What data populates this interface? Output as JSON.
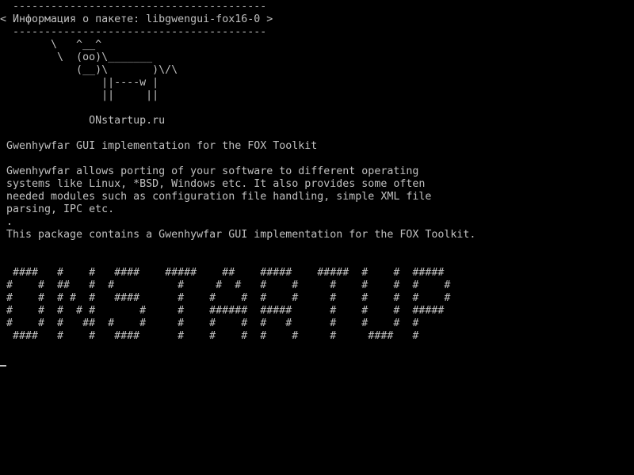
{
  "terminal": {
    "colors": {
      "background": "#000000",
      "foreground": "#c0c0c0"
    },
    "cowsay": {
      "border_top": " ----------------------------------------",
      "title": "< Информация о пакете: libgwengui-fox16-0 >",
      "border_bottom": " ----------------------------------------",
      "cow": [
        "       \\   ^__^",
        "        \\  (oo)\\_______",
        "           (__)\\       )\\/\\",
        "               ||----w |",
        "               ||     ||"
      ],
      "site": "             ONstartup.ru"
    },
    "description": {
      "summary": "Gwenhywfar GUI implementation for the FOX Toolkit",
      "body_lines": [
        "Gwenhywfar allows porting of your software to different operating",
        "systems like Linux, *BSD, Windows etc. It also provides some often",
        "needed modules such as configuration file handling, simple XML file",
        "parsing, IPC etc."
      ],
      "dot": ".",
      "package_note": "This package contains a Gwenhywfar GUI implementation for the FOX Toolkit."
    },
    "banner": [
      " ####   #    #   ####    #####    ##    #####    #####  #    #  #####",
      "#    #  ##   #  #          #     #  #   #    #     #    #    #  #    #",
      "#    #  # #  #   ####      #    #    #  #    #     #    #    #  #    #",
      "#    #  #  # #       #     #    ######  #####      #    #    #  #####",
      "#    #  #   ##  #    #     #    #    #  #   #      #    #    #  #",
      " ####   #    #   ####      #    #    #  #    #     #     ####   #"
    ]
  }
}
